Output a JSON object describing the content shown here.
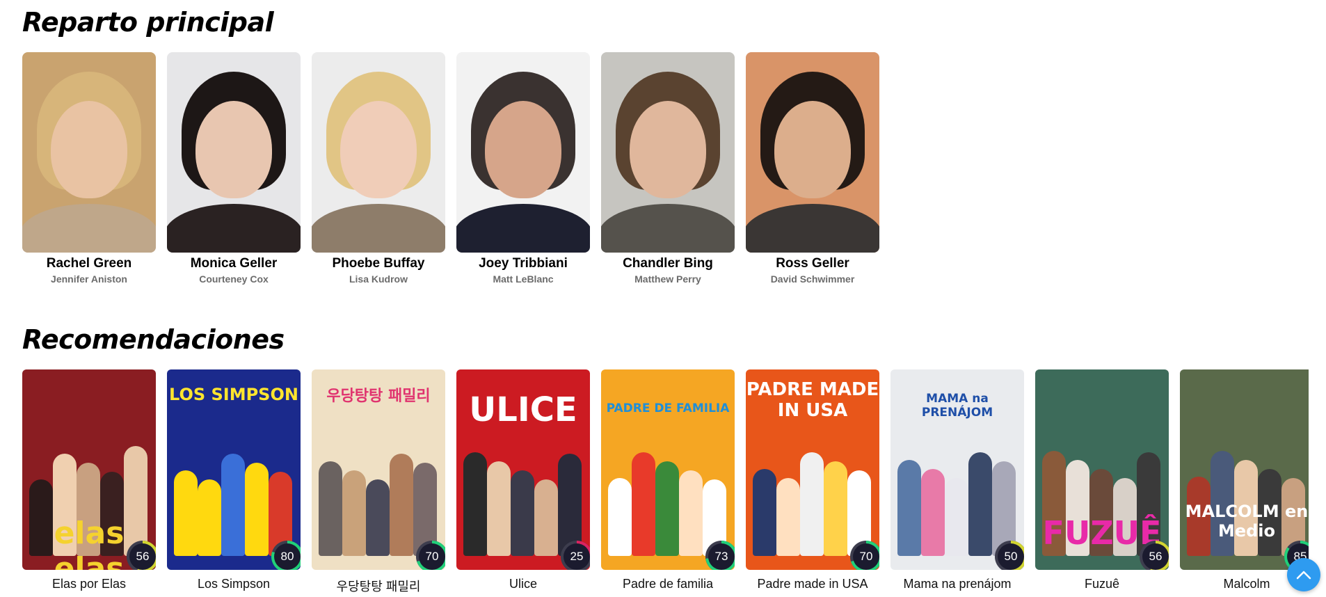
{
  "cast_section": {
    "title": "Reparto principal",
    "members": [
      {
        "character": "Rachel Green",
        "actor": "Jennifer Aniston",
        "bg": "#c9a36f",
        "hair": "#d7b57a",
        "skin": "#e9c3a3",
        "clothes": "#bfa78a"
      },
      {
        "character": "Monica Geller",
        "actor": "Courteney Cox",
        "bg": "#e6e6e8",
        "hair": "#1d1716",
        "skin": "#e8c6b0",
        "clothes": "#2a2222"
      },
      {
        "character": "Phoebe Buffay",
        "actor": "Lisa Kudrow",
        "bg": "#ececec",
        "hair": "#e1c585",
        "skin": "#f0cdb8",
        "clothes": "#8e7d6a"
      },
      {
        "character": "Joey Tribbiani",
        "actor": "Matt LeBlanc",
        "bg": "#f2f2f2",
        "hair": "#3a3230",
        "skin": "#d6a58a",
        "clothes": "#1e2030"
      },
      {
        "character": "Chandler Bing",
        "actor": "Matthew Perry",
        "bg": "#c6c5c0",
        "hair": "#5a4330",
        "skin": "#e0b79c",
        "clothes": "#55524c"
      },
      {
        "character": "Ross Geller",
        "actor": "David Schwimmer",
        "bg": "#d99468",
        "hair": "#241a15",
        "skin": "#dcae8c",
        "clothes": "#3a3634"
      }
    ]
  },
  "recommendations_section": {
    "title": "Recomendaciones",
    "items": [
      {
        "title": "Elas por Elas",
        "score": "56",
        "score_color": "#d2d531",
        "score_value": 56,
        "bg": "#8a1d22",
        "poster_text": "elas elas",
        "text_color": "#f5d22e",
        "text_size": 44,
        "text_top": 210,
        "figs": [
          "#2a1a1a",
          "#f0d0b0",
          "#c8a080",
          "#3a2020",
          "#e8c8a8"
        ]
      },
      {
        "title": "Los Simpson",
        "score": "80",
        "score_color": "#21d07a",
        "score_value": 80,
        "bg": "#1b2a8c",
        "poster_text": "LOS SIMPSON",
        "text_color": "#ffe52e",
        "text_size": 24,
        "text_top": 22,
        "figs": [
          "#ffd90f",
          "#ffd90f",
          "#3a6fd8",
          "#ffd90f",
          "#d93a2a"
        ]
      },
      {
        "title": "우당탕탕 패밀리",
        "score": "70",
        "score_color": "#21d07a",
        "score_value": 70,
        "bg": "#efe0c4",
        "poster_text": "우당탕탕 패밀리",
        "text_color": "#e0336f",
        "text_size": 22,
        "text_top": 20,
        "figs": [
          "#6a6260",
          "#c9a27a",
          "#4a4a5a",
          "#b07c5a",
          "#7a6a6a"
        ]
      },
      {
        "title": "Ulice",
        "score": "25",
        "score_color": "#db2360",
        "score_value": 25,
        "bg": "#cc1b22",
        "poster_text": "ULICE",
        "text_color": "#ffffff",
        "text_size": 48,
        "text_top": 30,
        "figs": [
          "#2a2a2a",
          "#e8c8a8",
          "#3a3a4a",
          "#d8b090",
          "#2a2a3a"
        ]
      },
      {
        "title": "Padre de familia",
        "score": "73",
        "score_color": "#21d07a",
        "score_value": 73,
        "bg": "#f5a623",
        "poster_text": "PADRE DE FAMILIA",
        "text_color": "#1f8fd8",
        "text_size": 17,
        "text_top": 46,
        "figs": [
          "#ffffff",
          "#e83a2a",
          "#3a8a3a",
          "#ffe0c0",
          "#ffffff"
        ]
      },
      {
        "title": "Padre made in USA",
        "score": "70",
        "score_color": "#21d07a",
        "score_value": 70,
        "bg": "#e8561a",
        "poster_text": "PADRE MADE IN USA",
        "text_color": "#ffffff",
        "text_size": 26,
        "text_top": 14,
        "figs": [
          "#2a3a6a",
          "#ffe0c0",
          "#f0f0f0",
          "#ffd24a",
          "#ffffff"
        ]
      },
      {
        "title": "Mama na prenájom",
        "score": "50",
        "score_color": "#d2d531",
        "score_value": 50,
        "bg": "#e9ebee",
        "poster_text": "MAMA na PRENÁJOM",
        "text_color": "#1f4fa8",
        "text_size": 17,
        "text_top": 32,
        "figs": [
          "#5a7aa8",
          "#e87aa8",
          "#e8e8ee",
          "#3a4a6a",
          "#a8a8b8"
        ]
      },
      {
        "title": "Fuzuê",
        "score": "56",
        "score_color": "#d2d531",
        "score_value": 56,
        "bg": "#3d6b5a",
        "poster_text": "FUZUÊ",
        "text_color": "#e82aa8",
        "text_size": 46,
        "text_top": 208,
        "figs": [
          "#8a5a3a",
          "#e8e0d8",
          "#6a4a3a",
          "#d8d0c8",
          "#3a3a3a"
        ]
      },
      {
        "title": "Malcolm",
        "score": "85",
        "score_color": "#21d07a",
        "score_value": 85,
        "bg": "#5a6a4a",
        "poster_text": "MALCOLM en Medio",
        "text_color": "#ffffff",
        "text_size": 24,
        "text_top": 190,
        "figs": [
          "#a83a2a",
          "#4a5a7a",
          "#e8c8a8",
          "#3a3a3a",
          "#c8a080"
        ]
      }
    ]
  },
  "scroll_top_button": {
    "icon": "chevron-up-icon",
    "color": "#2e9bf0"
  }
}
